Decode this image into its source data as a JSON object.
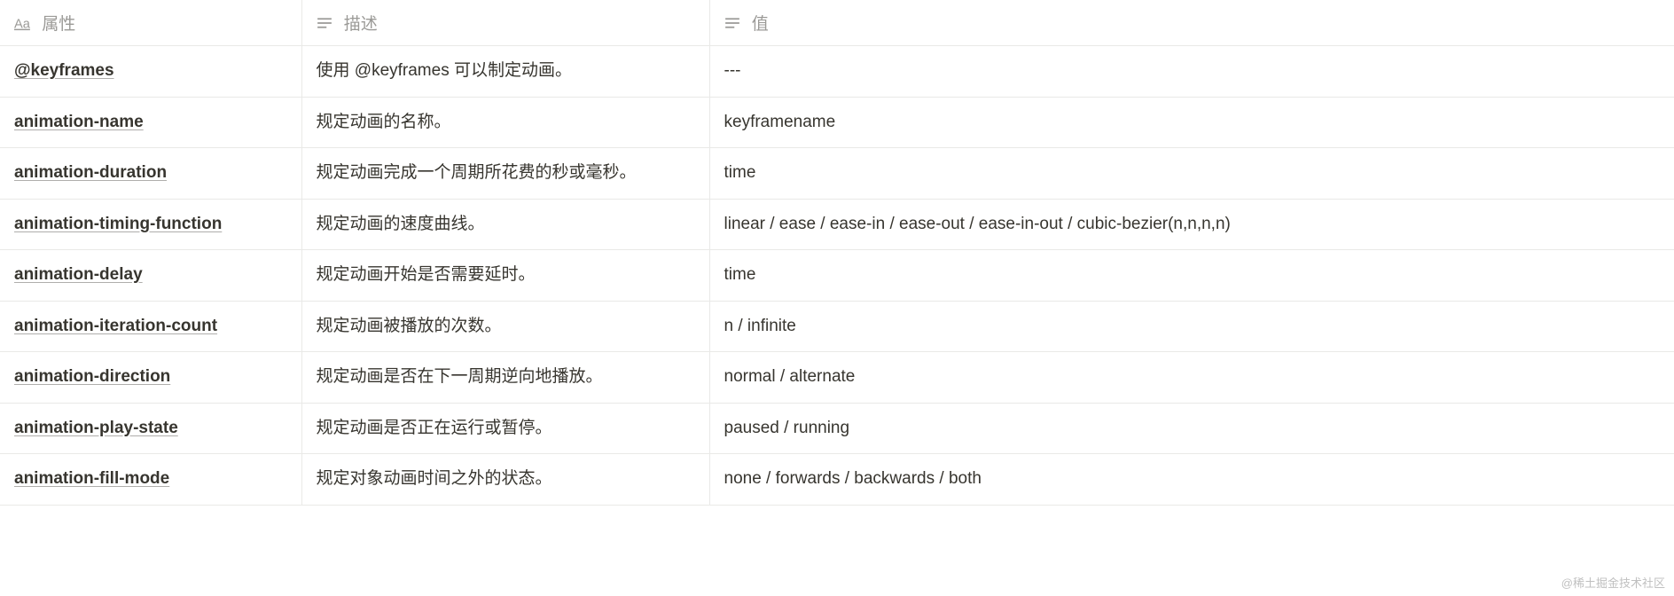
{
  "headers": {
    "property": "属性",
    "description": "描述",
    "value": "值"
  },
  "rows": [
    {
      "property": "@keyframes",
      "description": "使用 @keyframes 可以制定动画。",
      "value": "---"
    },
    {
      "property": "animation-name",
      "description": "规定动画的名称。",
      "value": "keyframename"
    },
    {
      "property": "animation-duration",
      "description": "规定动画完成一个周期所花费的秒或毫秒。",
      "value": "time"
    },
    {
      "property": "animation-timing-function",
      "description": "规定动画的速度曲线。",
      "value": "linear / ease / ease-in / ease-out / ease-in-out / cubic-bezier(n,n,n,n)"
    },
    {
      "property": "animation-delay",
      "description": "规定动画开始是否需要延时。",
      "value": "time"
    },
    {
      "property": "animation-iteration-count",
      "description": "规定动画被播放的次数。",
      "value": "n / infinite"
    },
    {
      "property": "animation-direction",
      "description": "规定动画是否在下一周期逆向地播放。",
      "value": "normal / alternate"
    },
    {
      "property": "animation-play-state",
      "description": "规定动画是否正在运行或暂停。",
      "value": "paused / running"
    },
    {
      "property": "animation-fill-mode",
      "description": "规定对象动画时间之外的状态。",
      "value": "none / forwards / backwards / both"
    }
  ],
  "watermark": "@稀土掘金技术社区"
}
